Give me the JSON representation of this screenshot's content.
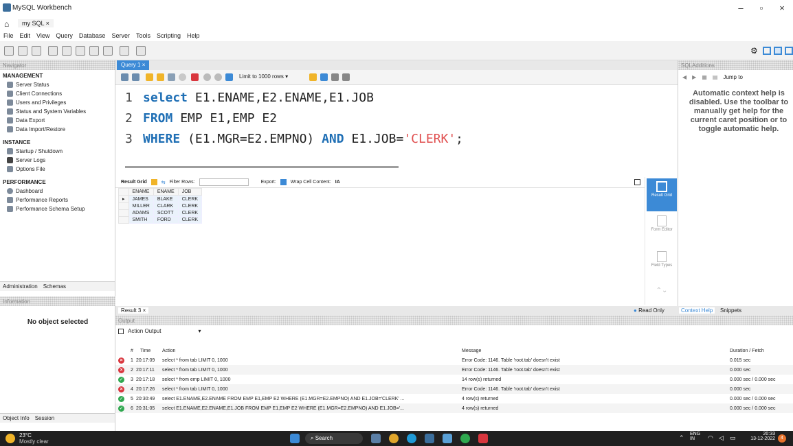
{
  "window": {
    "title": "MySQL Workbench",
    "minimize": "–",
    "maximize": "▫",
    "close": "×"
  },
  "tabs": {
    "connection": "my SQL ×"
  },
  "menu": [
    "File",
    "Edit",
    "View",
    "Query",
    "Database",
    "Server",
    "Tools",
    "Scripting",
    "Help"
  ],
  "navigator": {
    "header": "Navigator",
    "management": {
      "label": "MANAGEMENT",
      "items": [
        "Server Status",
        "Client Connections",
        "Users and Privileges",
        "Status and System Variables",
        "Data Export",
        "Data Import/Restore"
      ]
    },
    "instance": {
      "label": "INSTANCE",
      "items": [
        "Startup / Shutdown",
        "Server Logs",
        "Options File"
      ]
    },
    "performance": {
      "label": "PERFORMANCE",
      "items": [
        "Dashboard",
        "Performance Reports",
        "Performance Schema Setup"
      ]
    },
    "tabs": [
      "Administration",
      "Schemas"
    ],
    "information_header": "Information",
    "no_object": "No object selected",
    "bottom_tabs": [
      "Object Info",
      "Session"
    ]
  },
  "editor": {
    "tab_label": "Query 1",
    "tab_close": "×",
    "limit": "Limit to 1000 rows",
    "lines": [
      {
        "num": "1",
        "kw1": "select",
        "text": " E1.ENAME,E2.ENAME,E1.JOB"
      },
      {
        "num": "2",
        "kw1": "FROM",
        "text": " EMP E1,EMP E2"
      },
      {
        "num": "3",
        "kw1": "WHERE",
        "text": " (E1.MGR=E2.EMPNO) ",
        "kw2": "AND",
        "text2": " E1.JOB=",
        "str": "'CLERK'",
        "end": ";"
      }
    ]
  },
  "grid_toolbar": {
    "result_grid": "Result Grid",
    "filter_rows": "Filter Rows:",
    "export": "Export:",
    "wrap": "Wrap Cell Content:"
  },
  "result_grid": {
    "columns": [
      "ENAME",
      "ENAME",
      "JOB"
    ],
    "rows": [
      [
        "JAMES",
        "BLAKE",
        "CLERK"
      ],
      [
        "MILLER",
        "CLARK",
        "CLERK"
      ],
      [
        "ADAMS",
        "SCOTT",
        "CLERK"
      ],
      [
        "SMITH",
        "FORD",
        "CLERK"
      ]
    ]
  },
  "side_panel": {
    "result_grid": "Result Grid",
    "form_editor": "Form Editor",
    "field_types": "Field Types"
  },
  "result_tabs": {
    "result3": "Result 3",
    "close": "×",
    "read_only": "Read Only"
  },
  "sql_additions": {
    "header": "SQLAdditions",
    "jump_to": "Jump to",
    "help": "Automatic context help is disabled. Use the toolbar to manually get help for the current caret position or to toggle automatic help.",
    "tabs": [
      "Context Help",
      "Snippets"
    ]
  },
  "output": {
    "header": "Output",
    "selector": "Action Output",
    "columns": {
      "num": "#",
      "time": "Time",
      "action": "Action",
      "message": "Message",
      "duration": "Duration / Fetch"
    },
    "rows": [
      {
        "status": "error",
        "num": "1",
        "time": "20:17:09",
        "action": "select * from tab LIMIT 0, 1000",
        "message": "Error Code: 1146. Table 'root.tab' doesn't exist",
        "duration": "0.015 sec"
      },
      {
        "status": "error",
        "num": "2",
        "time": "20:17:11",
        "action": "select * from tab LIMIT 0, 1000",
        "message": "Error Code: 1146. Table 'root.tab' doesn't exist",
        "duration": "0.000 sec"
      },
      {
        "status": "ok",
        "num": "3",
        "time": "20:17:18",
        "action": "select * from emp LIMIT 0, 1000",
        "message": "14 row(s) returned",
        "duration": "0.000 sec / 0.000 sec"
      },
      {
        "status": "error",
        "num": "4",
        "time": "20:17:26",
        "action": "select * from tab LIMIT 0, 1000",
        "message": "Error Code: 1146. Table 'root.tab' doesn't exist",
        "duration": "0.000 sec"
      },
      {
        "status": "ok",
        "num": "5",
        "time": "20:30:49",
        "action": "select E1.ENAME,E2.ENAME FROM EMP E1,EMP E2 WHERE (E1.MGR=E2.EMPNO) AND E1.JOB='CLERK' ...",
        "message": "4 row(s) returned",
        "duration": "0.000 sec / 0.000 sec"
      },
      {
        "status": "ok",
        "num": "6",
        "time": "20:31:05",
        "action": "select E1.ENAME,E2.ENAME,E1.JOB FROM EMP E1,EMP E2 WHERE (E1.MGR=E2.EMPNO) AND E1.JOB='...",
        "message": "4 row(s) returned",
        "duration": "0.000 sec / 0.000 sec"
      }
    ]
  },
  "taskbar": {
    "temp": "23°C",
    "weather": "Mostly clear",
    "search": "Search",
    "lang1": "ENG",
    "lang2": "IN",
    "time": "20:33",
    "date": "13-12-2022",
    "notif": "4"
  },
  "colors": {
    "accent": "#3c8ad6",
    "keyword": "#1f6fb5",
    "string": "#e05050",
    "error": "#d9363e",
    "ok": "#2fa84f",
    "taskbar": "#202020"
  }
}
